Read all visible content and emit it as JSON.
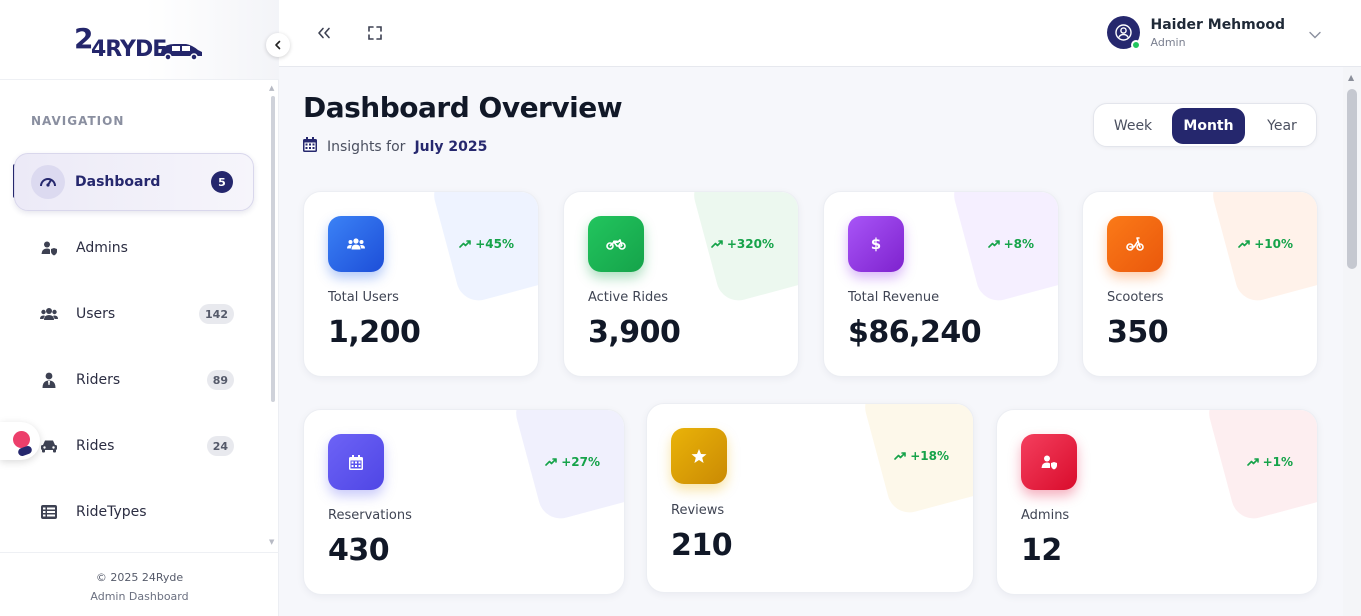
{
  "brand": {
    "logo_text": "24RYDE",
    "logo_number": "24"
  },
  "sidebar": {
    "section_label": "NAVIGATION",
    "items": [
      {
        "label": "Dashboard",
        "badge": "5",
        "icon": "speedometer-icon",
        "active": true
      },
      {
        "label": "Admins",
        "badge": "",
        "icon": "user-shield-icon"
      },
      {
        "label": "Users",
        "badge": "142",
        "icon": "users-icon"
      },
      {
        "label": "Riders",
        "badge": "89",
        "icon": "rider-icon"
      },
      {
        "label": "Rides",
        "badge": "24",
        "icon": "car-icon"
      },
      {
        "label": "RideTypes",
        "badge": "",
        "icon": "list-icon"
      }
    ],
    "footer": {
      "copyright": "© 2025 24Ryde",
      "subtitle": "Admin Dashboard"
    }
  },
  "topbar": {
    "user": {
      "name": "Haider Mehmood",
      "role": "Admin",
      "status": "online"
    }
  },
  "main": {
    "title": "Dashboard Overview",
    "insights_prefix": "Insights for",
    "insights_period": "July 2025",
    "period_options": [
      "Week",
      "Month",
      "Year"
    ],
    "period_selected": "Month",
    "stats_row1": [
      {
        "label": "Total Users",
        "value": "1,200",
        "trend": "+45%",
        "icon": "users-icon",
        "color": "#2563eb"
      },
      {
        "label": "Active Rides",
        "value": "3,900",
        "trend": "+320%",
        "icon": "motorcycle-icon",
        "color": "#16a34a"
      },
      {
        "label": "Total Revenue",
        "value": "$86,240",
        "trend": "+8%",
        "icon": "dollar-icon",
        "color": "#9333ea"
      },
      {
        "label": "Scooters",
        "value": "350",
        "trend": "+10%",
        "icon": "scooter-icon",
        "color": "#f97316"
      }
    ],
    "stats_row2": [
      {
        "label": "Reservations",
        "value": "430",
        "trend": "+27%",
        "icon": "calendar-icon",
        "color": "#6366f1"
      },
      {
        "label": "Reviews",
        "value": "210",
        "trend": "+18%",
        "icon": "star-icon",
        "color": "#eab308"
      },
      {
        "label": "Admins",
        "value": "12",
        "trend": "+1%",
        "icon": "user-shield-icon",
        "color": "#e11d48"
      }
    ]
  },
  "colors": {
    "primary": "#25276d",
    "positive": "#16a34a",
    "background": "#f6f7fb"
  }
}
